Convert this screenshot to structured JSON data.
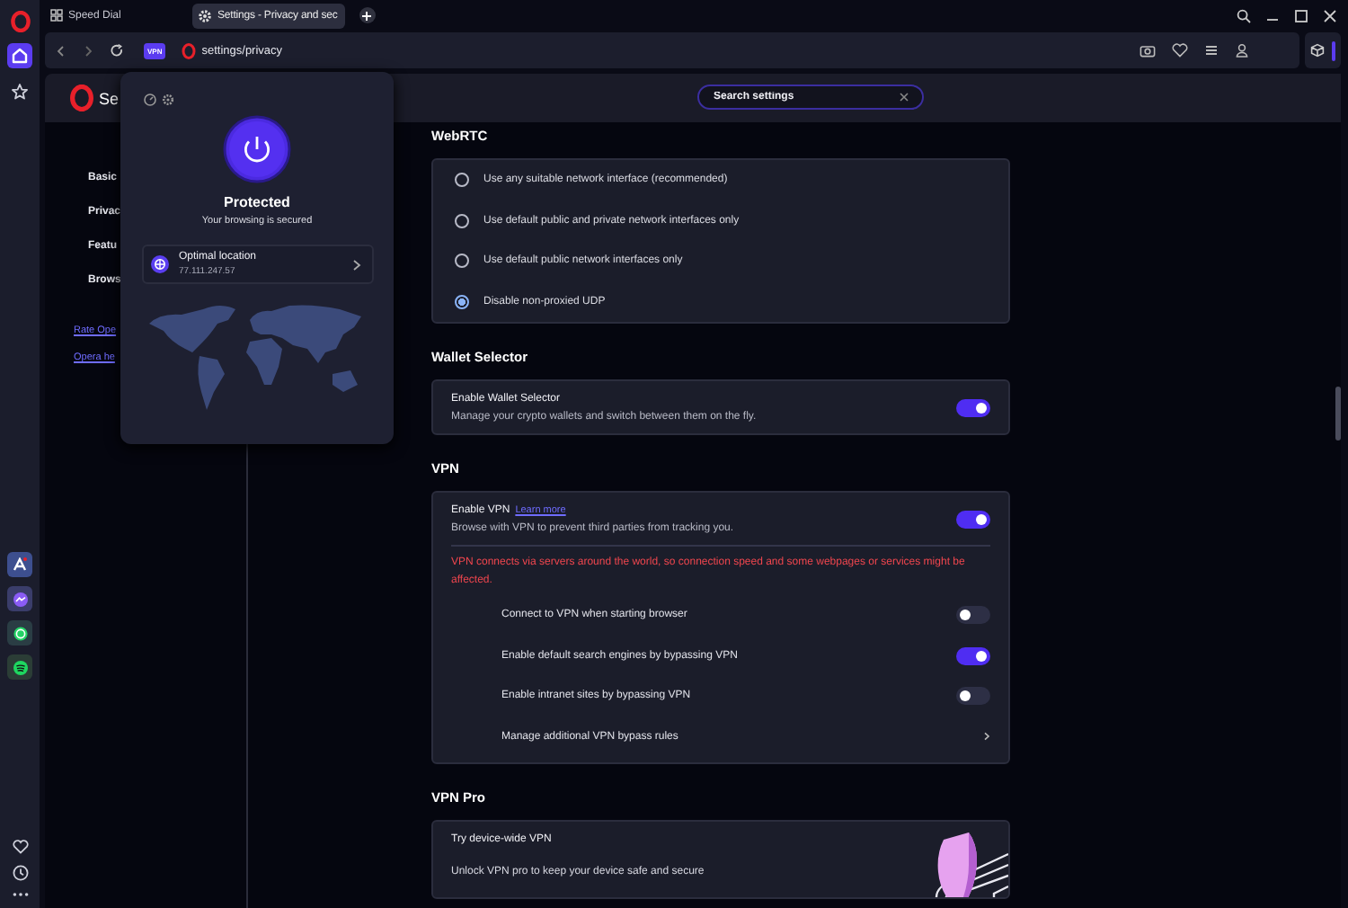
{
  "sidebar": {
    "items": [
      {
        "kind": "home",
        "selected": true
      },
      {
        "kind": "bookmarks",
        "selected": false
      }
    ]
  },
  "tabs": [
    {
      "kind": "speed-dial",
      "label": "Speed Dial",
      "selected": false
    },
    {
      "kind": "settings",
      "label": "Settings - Privacy and sec",
      "selected": true
    }
  ],
  "address_bar": {
    "badge": "VPN",
    "url": "settings/privacy"
  },
  "settings_header": {
    "title": "Se",
    "search": {
      "placeholder": "Search settings"
    }
  },
  "nav": {
    "items": [
      "Basic",
      "Privac",
      "Featu",
      "Brows"
    ],
    "links": [
      "Rate Ope",
      "Opera he"
    ]
  },
  "vpn_popup": {
    "status": "Protected",
    "subtitle": "Your browsing is secured",
    "location": {
      "name": "Optimal location",
      "ip": "77.111.247.57"
    }
  },
  "sections": [
    {
      "kind": "radio",
      "title": "WebRTC",
      "options": [
        {
          "label": "Use any suitable network interface (recommended)",
          "selected": false
        },
        {
          "label": "Use default public and private network interfaces only",
          "selected": false
        },
        {
          "label": "Use default public network interfaces only",
          "selected": false
        },
        {
          "label": "Disable non-proxied UDP",
          "selected": true
        }
      ]
    },
    {
      "kind": "toggle",
      "title": "Wallet Selector",
      "label": "Enable Wallet Selector",
      "description": "Manage your crypto wallets and switch between them on the fly.",
      "on": true
    },
    {
      "kind": "vpn",
      "title": "VPN",
      "label": "Enable VPN",
      "link": "Learn more",
      "description": "Browse with VPN to prevent third parties from tracking you.",
      "on": true,
      "warning": "VPN connects via servers around the world, so connection speed and some webpages or services might be affected.",
      "options": [
        {
          "kind": "toggle",
          "label": "Connect to VPN when starting browser",
          "on": false
        },
        {
          "kind": "toggle",
          "label": "Enable default search engines by bypassing VPN",
          "on": true
        },
        {
          "kind": "toggle",
          "label": "Enable intranet sites by bypassing VPN",
          "on": false
        },
        {
          "kind": "link",
          "label": "Manage additional VPN bypass rules"
        }
      ]
    },
    {
      "kind": "promo",
      "title": "VPN Pro",
      "heading": "Try device-wide VPN",
      "text": "Unlock VPN pro to keep your device safe and secure"
    }
  ]
}
